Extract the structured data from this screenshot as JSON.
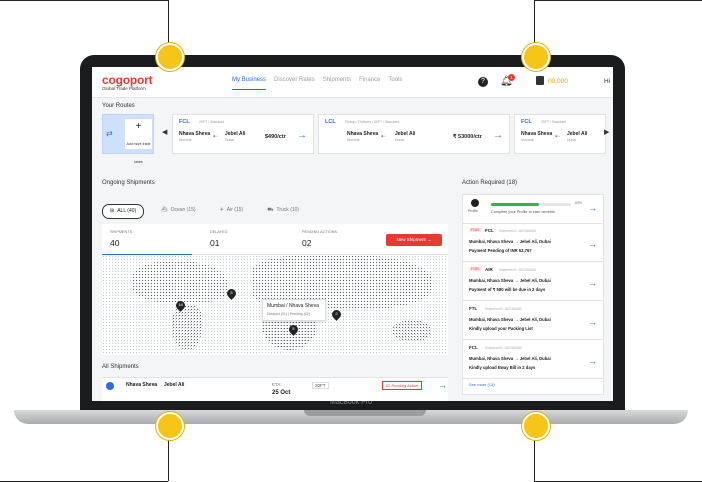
{
  "laptop": {
    "model_label": "MacBook Pro"
  },
  "callout_color": "#f5c518",
  "header": {
    "logo": "cogoport",
    "tagline": "Global Trade Platform",
    "nav": [
      "My Business",
      "Discover Rates",
      "Shipments",
      "Finance",
      "Tools"
    ],
    "active_nav": "My Business",
    "notifications_badge": "1",
    "wallet_value": "00,000",
    "greeting": "Hi"
  },
  "routes": {
    "title": "Your Routes",
    "add_lane_label": "Add more trade lanes",
    "cards": [
      {
        "type": "FCL",
        "meta": "20FT / Standard",
        "origin": "Nhava Sheva",
        "origin_sub": "Mumbai",
        "dest": "Jebel Ali",
        "dest_sub": "Dubai",
        "price": "$490/ctr"
      },
      {
        "type": "LCL",
        "meta": "Pickup / Delivery / 20FT / Standard",
        "origin": "Nhava Sheva",
        "origin_sub": "Mumbai",
        "dest": "Jebel Ali",
        "dest_sub": "Dubai",
        "price": "₹ 53000/ctr"
      },
      {
        "type": "FCL",
        "meta": "20FT / Standard",
        "origin": "Nhava Sheva",
        "origin_sub": "Mumbai",
        "dest": "Jebel Ali",
        "dest_sub": "Dubai",
        "price": ""
      }
    ]
  },
  "ongoing": {
    "title": "Ongoing Shipments",
    "filters": [
      "ALL (40)",
      "Ocean (15)",
      "Air (15)",
      "Truck (10)"
    ],
    "stats": [
      {
        "label": "SHIPMENTS",
        "value": "40"
      },
      {
        "label": "DELAYED",
        "value": "01"
      },
      {
        "label": "PENDING ACTIONS",
        "value": "02"
      }
    ],
    "new_shipment_label": "New Shipment",
    "map_pins": [
      "18",
      "5",
      "5",
      "2"
    ],
    "map_tooltip": {
      "title": "Mumbai / Nhava Sheva",
      "status": "Delayed (01) | Pending (02)"
    }
  },
  "all_shipments": {
    "title": "All Shipments",
    "row": {
      "origin": "Nhava Sheva",
      "dest": "Jebel Ali",
      "eta_label": "ETA:",
      "eta": "25 Oct",
      "container": "20FT",
      "pending": "02 Pending Action"
    }
  },
  "actions": {
    "title": "Action Required (18)",
    "profile": {
      "label": "Profile",
      "message": "Complete your Profile to earn benefits",
      "progress": 0.6,
      "progress_label": "60%"
    },
    "items": [
      {
        "tag": "FOB",
        "type": "FCL",
        "id": "Shipment ID: 1827466430",
        "route": "Mumbai, Nhava Sheva → Jebel Ali, Dubai",
        "message": "Payment Pending of INR 53,767"
      },
      {
        "tag": "FOB",
        "type": "AIR",
        "id": "Shipment ID: 1827466430",
        "route": "Mumbai, Nhava Sheva → Jebel Ali, Dubai",
        "message": "Payment of ₹ 580 will be due in 2 days"
      },
      {
        "tag": "",
        "type": "FTL",
        "id": "Shipment ID: 1827466430",
        "route": "Mumbai, Nhava Sheva → Jebel Ali, Dubai",
        "message": "Kindly upload your Packing List"
      },
      {
        "tag": "",
        "type": "FCL",
        "id": "Shipment ID: 1827466430",
        "route": "Mumbai, Nhava Sheva → Jebel Ali, Dubai",
        "message": "Kindly upload Eway Bill in 2 days"
      }
    ],
    "see_more": "See more (13)"
  }
}
